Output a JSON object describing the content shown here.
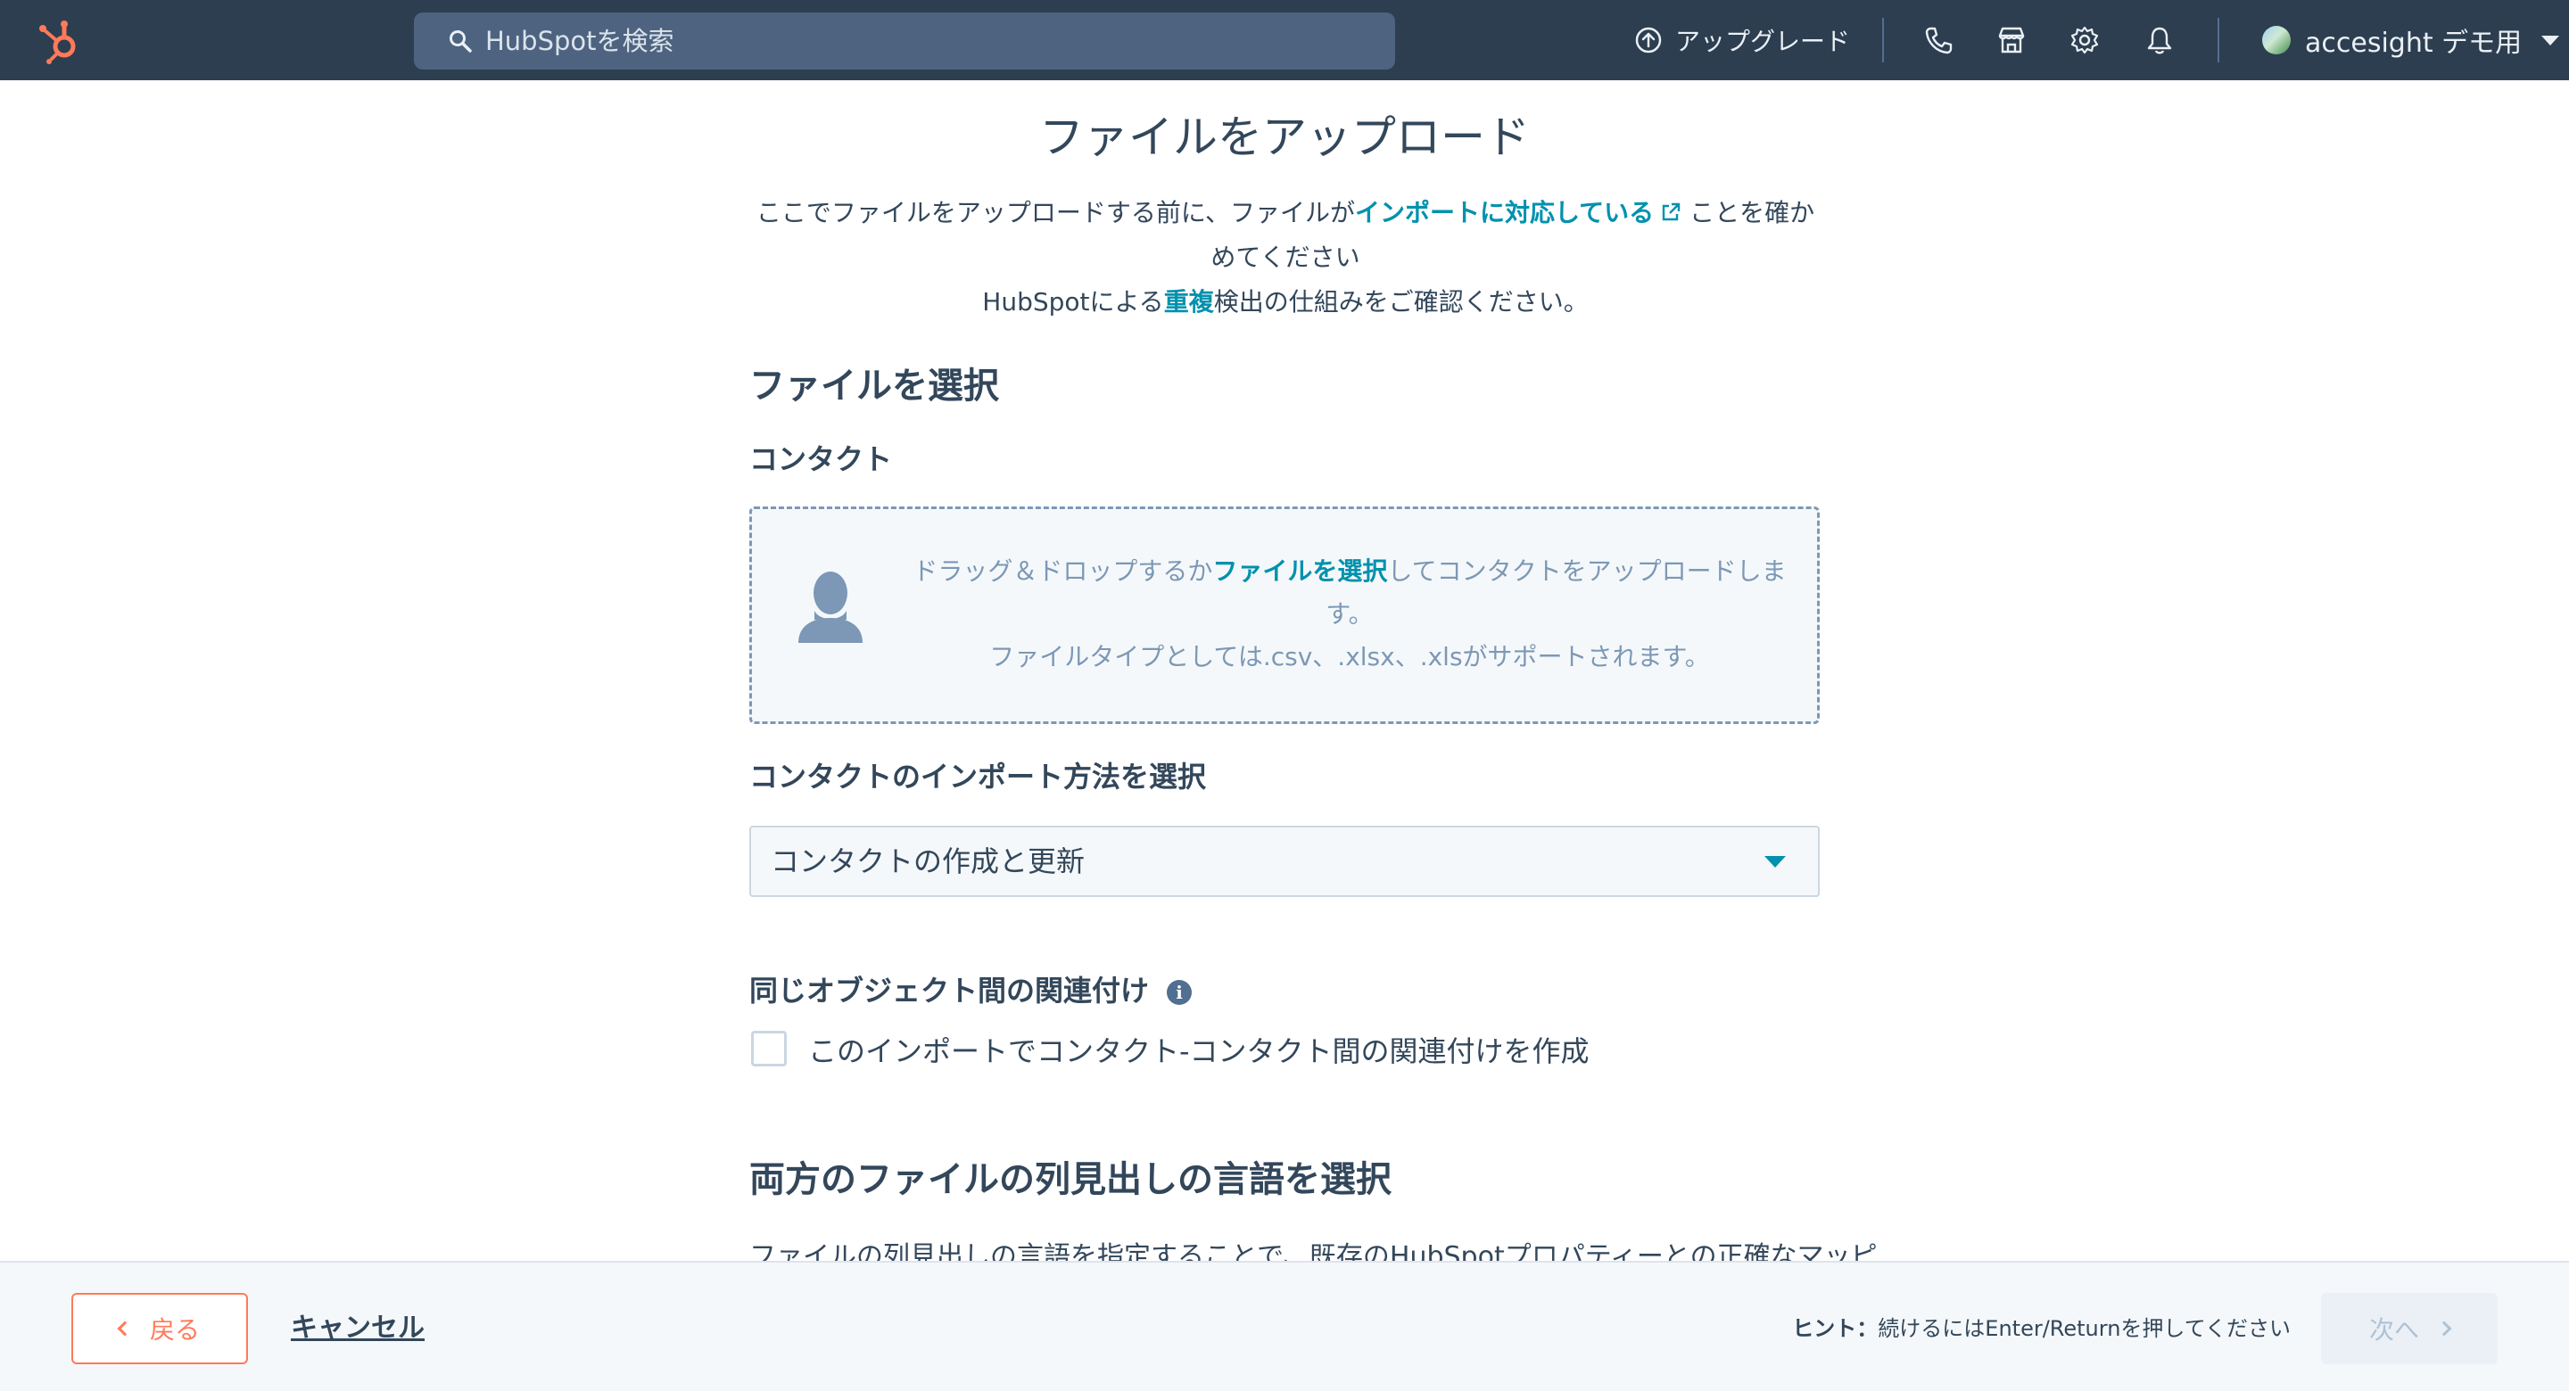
{
  "topnav": {
    "search_placeholder": "HubSpotを検索",
    "upgrade_label": "アップグレード",
    "account_name": "accesight デモ用",
    "icons": [
      "hubspot-logo",
      "search-icon",
      "upgrade-icon",
      "phone-icon",
      "marketplace-icon",
      "settings-icon",
      "notifications-icon",
      "avatar",
      "chevron-down-icon"
    ]
  },
  "page": {
    "title": "ファイルをアップロード",
    "intro_1a": "ここでファイルをアップロードする前に、ファイルが",
    "intro_link_import": "インポートに対応している",
    "intro_1b": "ことを確かめてください",
    "intro_2a": "HubSpotによる",
    "intro_link_dup": "重複",
    "intro_2b": "検出の仕組みをご確認ください。",
    "choose_file_heading": "ファイルを選択",
    "object_label": "コンタクト",
    "dropzone": {
      "text_a": "ドラッグ＆ドロップするか",
      "link": "ファイルを選択",
      "text_b": "してコンタクトをアップロードします。",
      "types": "ファイルタイプとしては.csv、.xlsx、.xlsがサポートされます。"
    },
    "import_method_heading": "コンタクトのインポート方法を選択",
    "import_method_value": "コンタクトの作成と更新",
    "association_heading": "同じオブジェクト間の関連付け",
    "association_checkbox_label": "このインポートでコンタクト-コンタクト間の関連付けを作成",
    "language_heading": "両方のファイルの列見出しの言語を選択",
    "language_desc": "ファイルの列見出しの言語を指定することで、既存のHubSpotプロパティーとの正確なマッピ"
  },
  "footer": {
    "back_label": "戻る",
    "cancel_label": "キャンセル",
    "hint_prefix": "ヒント：",
    "hint_text": "続けるにはEnter/Returnを押してください",
    "next_label": "次へ"
  },
  "colors": {
    "nav_bg": "#2d3e50",
    "accent_orange": "#ff7a59",
    "link_teal": "#0091ae",
    "text_dark": "#33475b"
  }
}
